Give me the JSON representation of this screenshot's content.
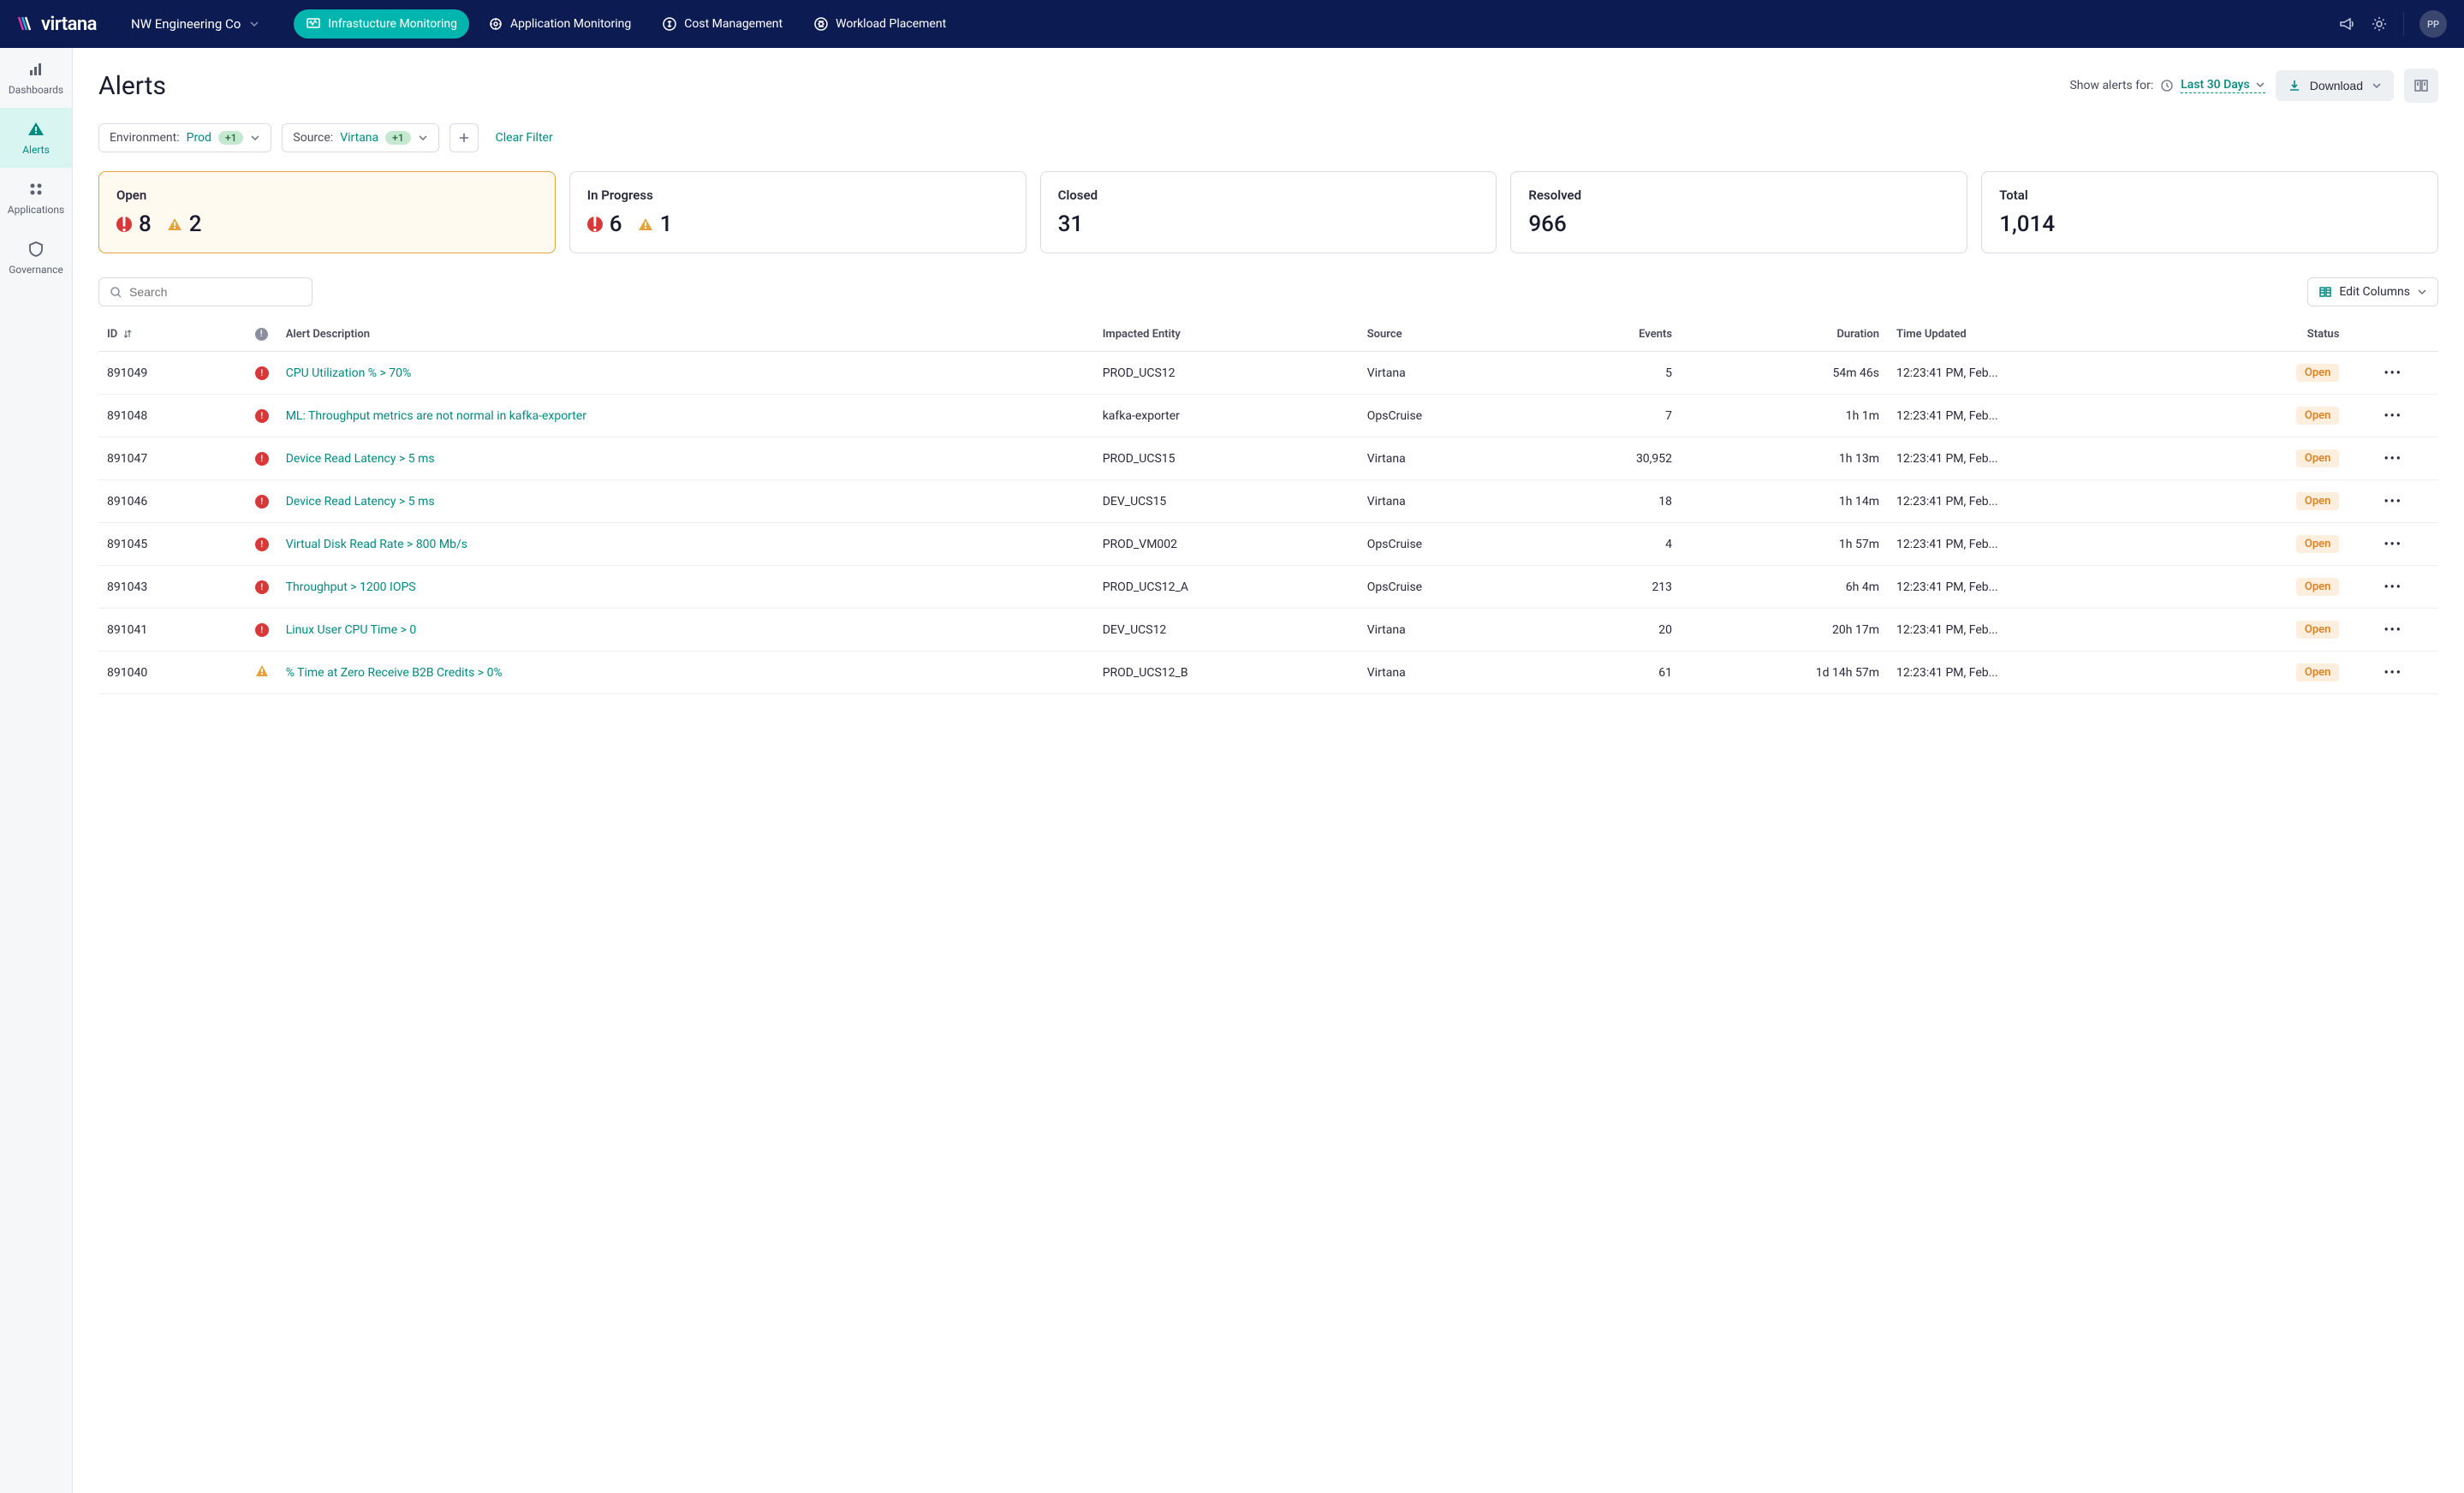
{
  "brand": {
    "name": "virtana",
    "user_initials": "PP"
  },
  "org": {
    "name": "NW Engineering Co"
  },
  "top_nav": [
    {
      "icon": "monitor-icon",
      "label": "Infrastucture Monitoring",
      "active": true
    },
    {
      "icon": "app-monitor-icon",
      "label": "Application Monitoring",
      "active": false
    },
    {
      "icon": "cost-icon",
      "label": "Cost Management",
      "active": false
    },
    {
      "icon": "workload-icon",
      "label": "Workload Placement",
      "active": false
    }
  ],
  "side_nav": [
    {
      "icon": "dashboards-icon",
      "label": "Dashboards",
      "active": false
    },
    {
      "icon": "alerts-icon",
      "label": "Alerts",
      "active": true
    },
    {
      "icon": "applications-icon",
      "label": "Applications",
      "active": false
    },
    {
      "icon": "governance-icon",
      "label": "Governance",
      "active": false
    }
  ],
  "page": {
    "title": "Alerts",
    "show_alerts_label": "Show alerts for:",
    "date_range": "Last 30 Days",
    "download_label": "Download",
    "search_placeholder": "Search",
    "edit_columns_label": "Edit Columns",
    "clear_filter_label": "Clear Filter"
  },
  "filters": [
    {
      "label": "Environment:",
      "value": "Prod",
      "extra": "+1"
    },
    {
      "label": "Source:",
      "value": "Virtana",
      "extra": "+1"
    }
  ],
  "stats": [
    {
      "key": "open",
      "label": "Open",
      "crit": "8",
      "warn": "2",
      "selected": true
    },
    {
      "key": "in_progress",
      "label": "In Progress",
      "crit": "6",
      "warn": "1",
      "selected": false
    },
    {
      "key": "closed",
      "label": "Closed",
      "total": "31",
      "selected": false
    },
    {
      "key": "resolved",
      "label": "Resolved",
      "total": "966",
      "selected": false
    },
    {
      "key": "total",
      "label": "Total",
      "total": "1,014",
      "selected": false
    }
  ],
  "columns": {
    "id": "ID",
    "severity": "",
    "description": "Alert Description",
    "impacted": "Impacted Entity",
    "source": "Source",
    "events": "Events",
    "duration": "Duration",
    "updated": "Time Updated",
    "status": "Status"
  },
  "rows": [
    {
      "id": "891049",
      "sev": "crit",
      "description": "CPU Utilization % > 70%",
      "impacted": "PROD_UCS12",
      "source": "Virtana",
      "events": "5",
      "duration": "54m 46s",
      "updated": "12:23:41 PM, Feb...",
      "status": "Open"
    },
    {
      "id": "891048",
      "sev": "crit",
      "description": "ML: Throughput metrics are not normal in kafka-exporter",
      "impacted": "kafka-exporter",
      "source": "OpsCruise",
      "events": "7",
      "duration": "1h 1m",
      "updated": "12:23:41 PM, Feb...",
      "status": "Open"
    },
    {
      "id": "891047",
      "sev": "crit",
      "description": "Device Read Latency > 5 ms",
      "impacted": "PROD_UCS15",
      "source": "Virtana",
      "events": "30,952",
      "duration": "1h 13m",
      "updated": "12:23:41 PM, Feb...",
      "status": "Open"
    },
    {
      "id": "891046",
      "sev": "crit",
      "description": "Device Read Latency > 5 ms",
      "impacted": "DEV_UCS15",
      "source": "Virtana",
      "events": "18",
      "duration": "1h 14m",
      "updated": "12:23:41 PM, Feb...",
      "status": "Open"
    },
    {
      "id": "891045",
      "sev": "crit",
      "description": "Virtual Disk Read Rate > 800 Mb/s",
      "impacted": "PROD_VM002",
      "source": "OpsCruise",
      "events": "4",
      "duration": "1h 57m",
      "updated": "12:23:41 PM, Feb...",
      "status": "Open"
    },
    {
      "id": "891043",
      "sev": "crit",
      "description": "Throughput > 1200 IOPS",
      "impacted": "PROD_UCS12_A",
      "source": "OpsCruise",
      "events": "213",
      "duration": "6h 4m",
      "updated": "12:23:41 PM, Feb...",
      "status": "Open"
    },
    {
      "id": "891041",
      "sev": "crit",
      "description": "Linux User CPU Time > 0",
      "impacted": "DEV_UCS12",
      "source": "Virtana",
      "events": "20",
      "duration": "20h 17m",
      "updated": "12:23:41 PM, Feb...",
      "status": "Open"
    },
    {
      "id": "891040",
      "sev": "warn",
      "description": "% Time at Zero Receive B2B Credits > 0%",
      "impacted": "PROD_UCS12_B",
      "source": "Virtana",
      "events": "61",
      "duration": "1d 14h 57m",
      "updated": "12:23:41 PM, Feb...",
      "status": "Open"
    }
  ]
}
